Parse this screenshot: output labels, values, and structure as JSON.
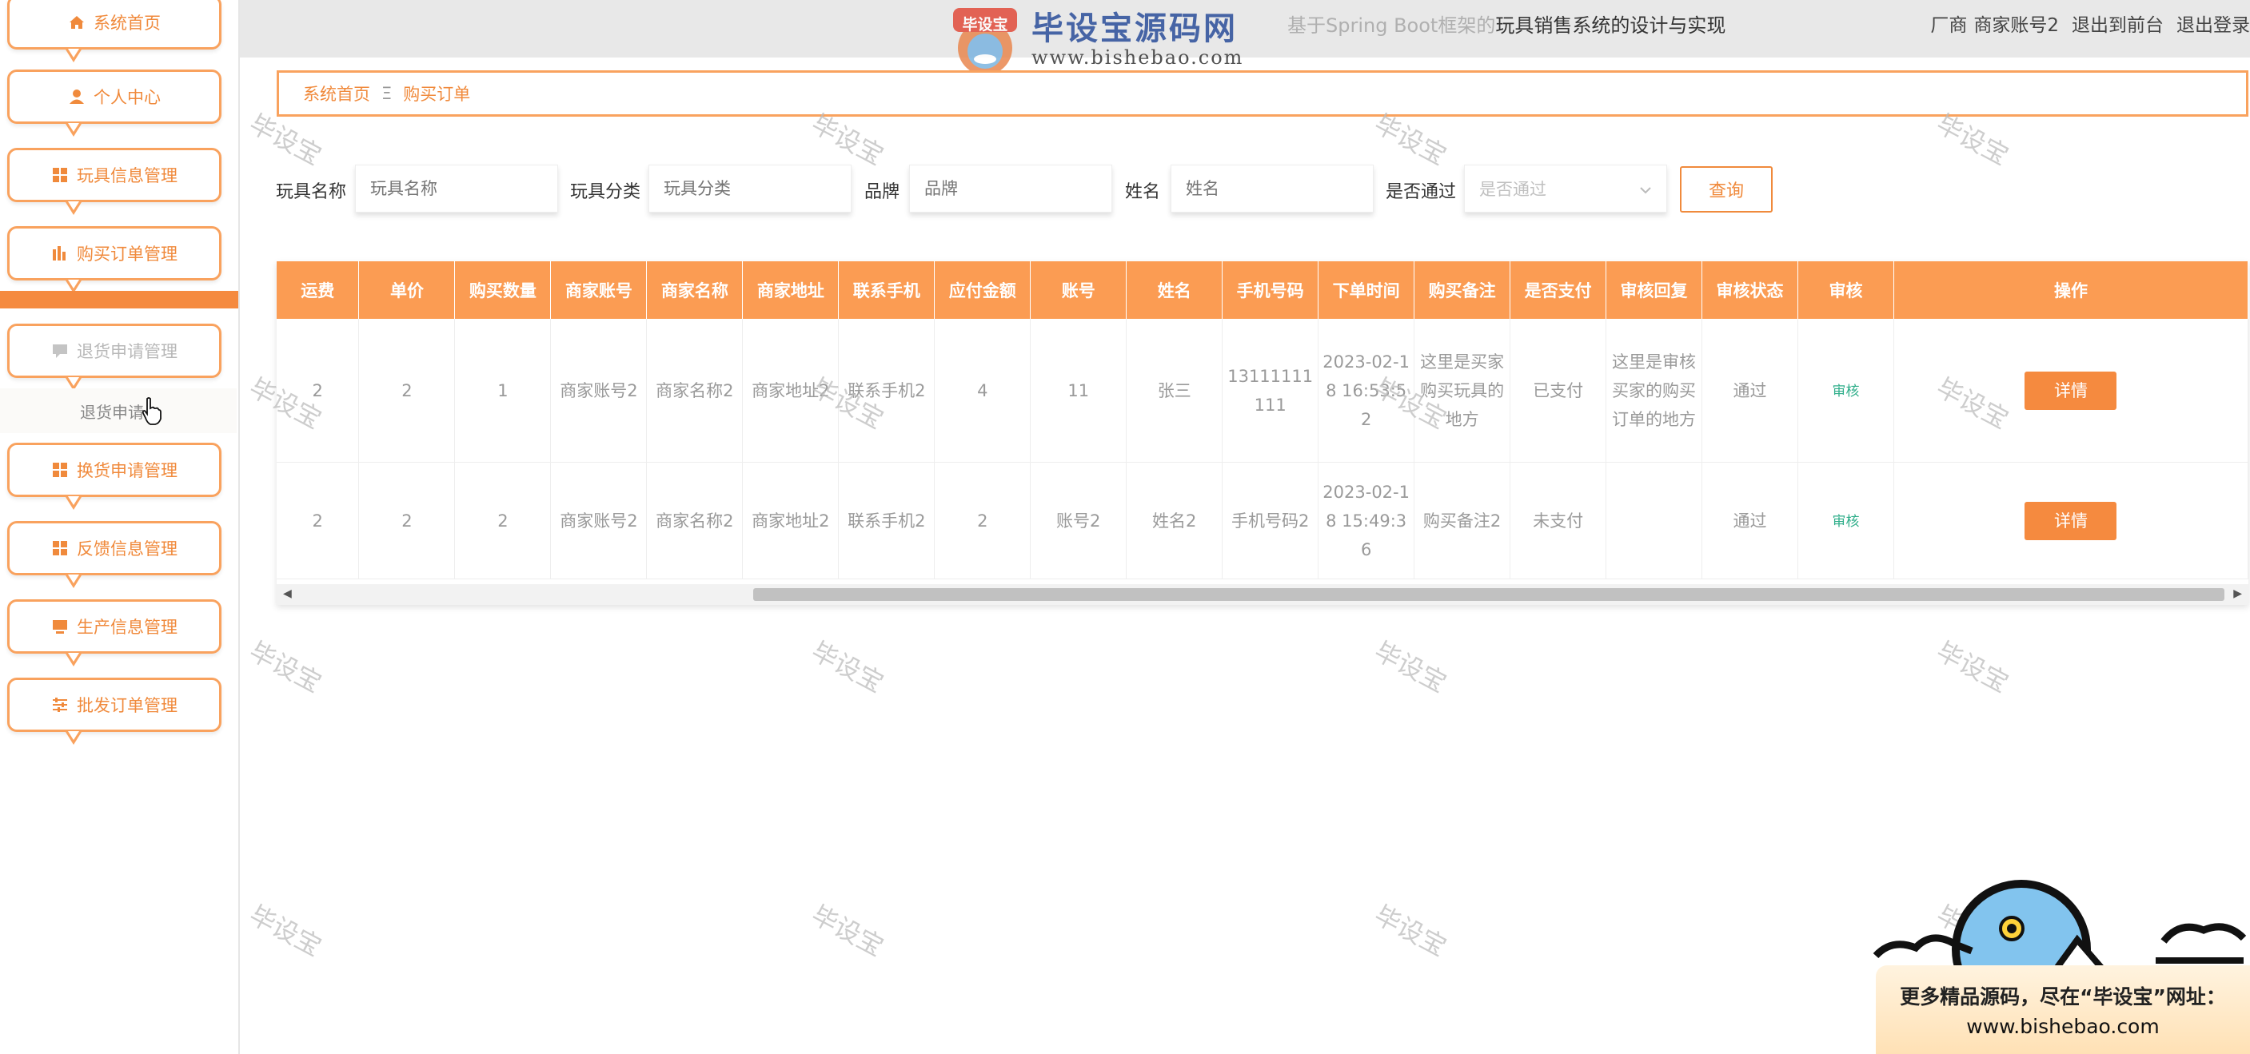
{
  "topbar": {
    "title_faded": "基于Spring Boot框架的",
    "title_main": "玩具销售系统的设计与实现",
    "user_role": "厂商",
    "user_name": "商家账号2",
    "links": [
      "退出到前台",
      "退出登录"
    ]
  },
  "logo_watermark": {
    "badge": "毕设宝",
    "name": "毕设宝源码网",
    "url": "www.bishebao.com"
  },
  "sidebar": {
    "items": [
      {
        "label": "系统首页",
        "icon": "home-icon"
      },
      {
        "label": "个人中心",
        "icon": "user-icon"
      },
      {
        "label": "玩具信息管理",
        "icon": "grid-icon"
      },
      {
        "label": "购买订单管理",
        "icon": "chart-icon"
      },
      {
        "label": "退货申请管理",
        "icon": "message-icon"
      },
      {
        "label": "换货申请管理",
        "icon": "grid-icon"
      },
      {
        "label": "反馈信息管理",
        "icon": "grid-icon"
      },
      {
        "label": "生产信息管理",
        "icon": "monitor-icon"
      },
      {
        "label": "批发订单管理",
        "icon": "sliders-icon"
      }
    ],
    "submenu_item": "退货申请"
  },
  "breadcrumb": {
    "home": "系统首页",
    "separator": "Ξ",
    "current": "购买订单"
  },
  "search": {
    "fields": [
      {
        "label": "玩具名称",
        "placeholder": "玩具名称"
      },
      {
        "label": "玩具分类",
        "placeholder": "玩具分类"
      },
      {
        "label": "品牌",
        "placeholder": "品牌"
      },
      {
        "label": "姓名",
        "placeholder": "姓名"
      },
      {
        "label": "是否通过",
        "placeholder": "是否通过"
      }
    ],
    "button": "查询"
  },
  "table": {
    "headers": [
      "运费",
      "单价",
      "购买数量",
      "商家账号",
      "商家名称",
      "商家地址",
      "联系手机",
      "应付金额",
      "账号",
      "姓名",
      "手机号码",
      "下单时间",
      "购买备注",
      "是否支付",
      "审核回复",
      "审核状态",
      "审核",
      "操作"
    ],
    "rows": [
      [
        "2",
        "2",
        "1",
        "商家账号2",
        "商家名称2",
        "商家地址2",
        "联系手机2",
        "4",
        "11",
        "张三",
        "13111111111",
        "2023-02-18 16:53:52",
        "这里是买家购买玩具的地方",
        "已支付",
        "这里是审核买家的购买订单的地方",
        "通过",
        "审核",
        "详情"
      ],
      [
        "2",
        "2",
        "2",
        "商家账号2",
        "商家名称2",
        "商家地址2",
        "联系手机2",
        "2",
        "账号2",
        "姓名2",
        "手机号码2",
        "2023-02-18 15:49:36",
        "购买备注2",
        "未支付",
        "",
        "通过",
        "审核",
        "详情"
      ]
    ]
  },
  "watermark_text": "毕设宝",
  "promo": {
    "line1": "更多精品源码，尽在“毕设宝”网址：",
    "line2": "www.bishebao.com"
  },
  "colors": {
    "accent": "#f58a3f",
    "table_header": "#fb9c53",
    "audit_link": "#2fae8a"
  }
}
